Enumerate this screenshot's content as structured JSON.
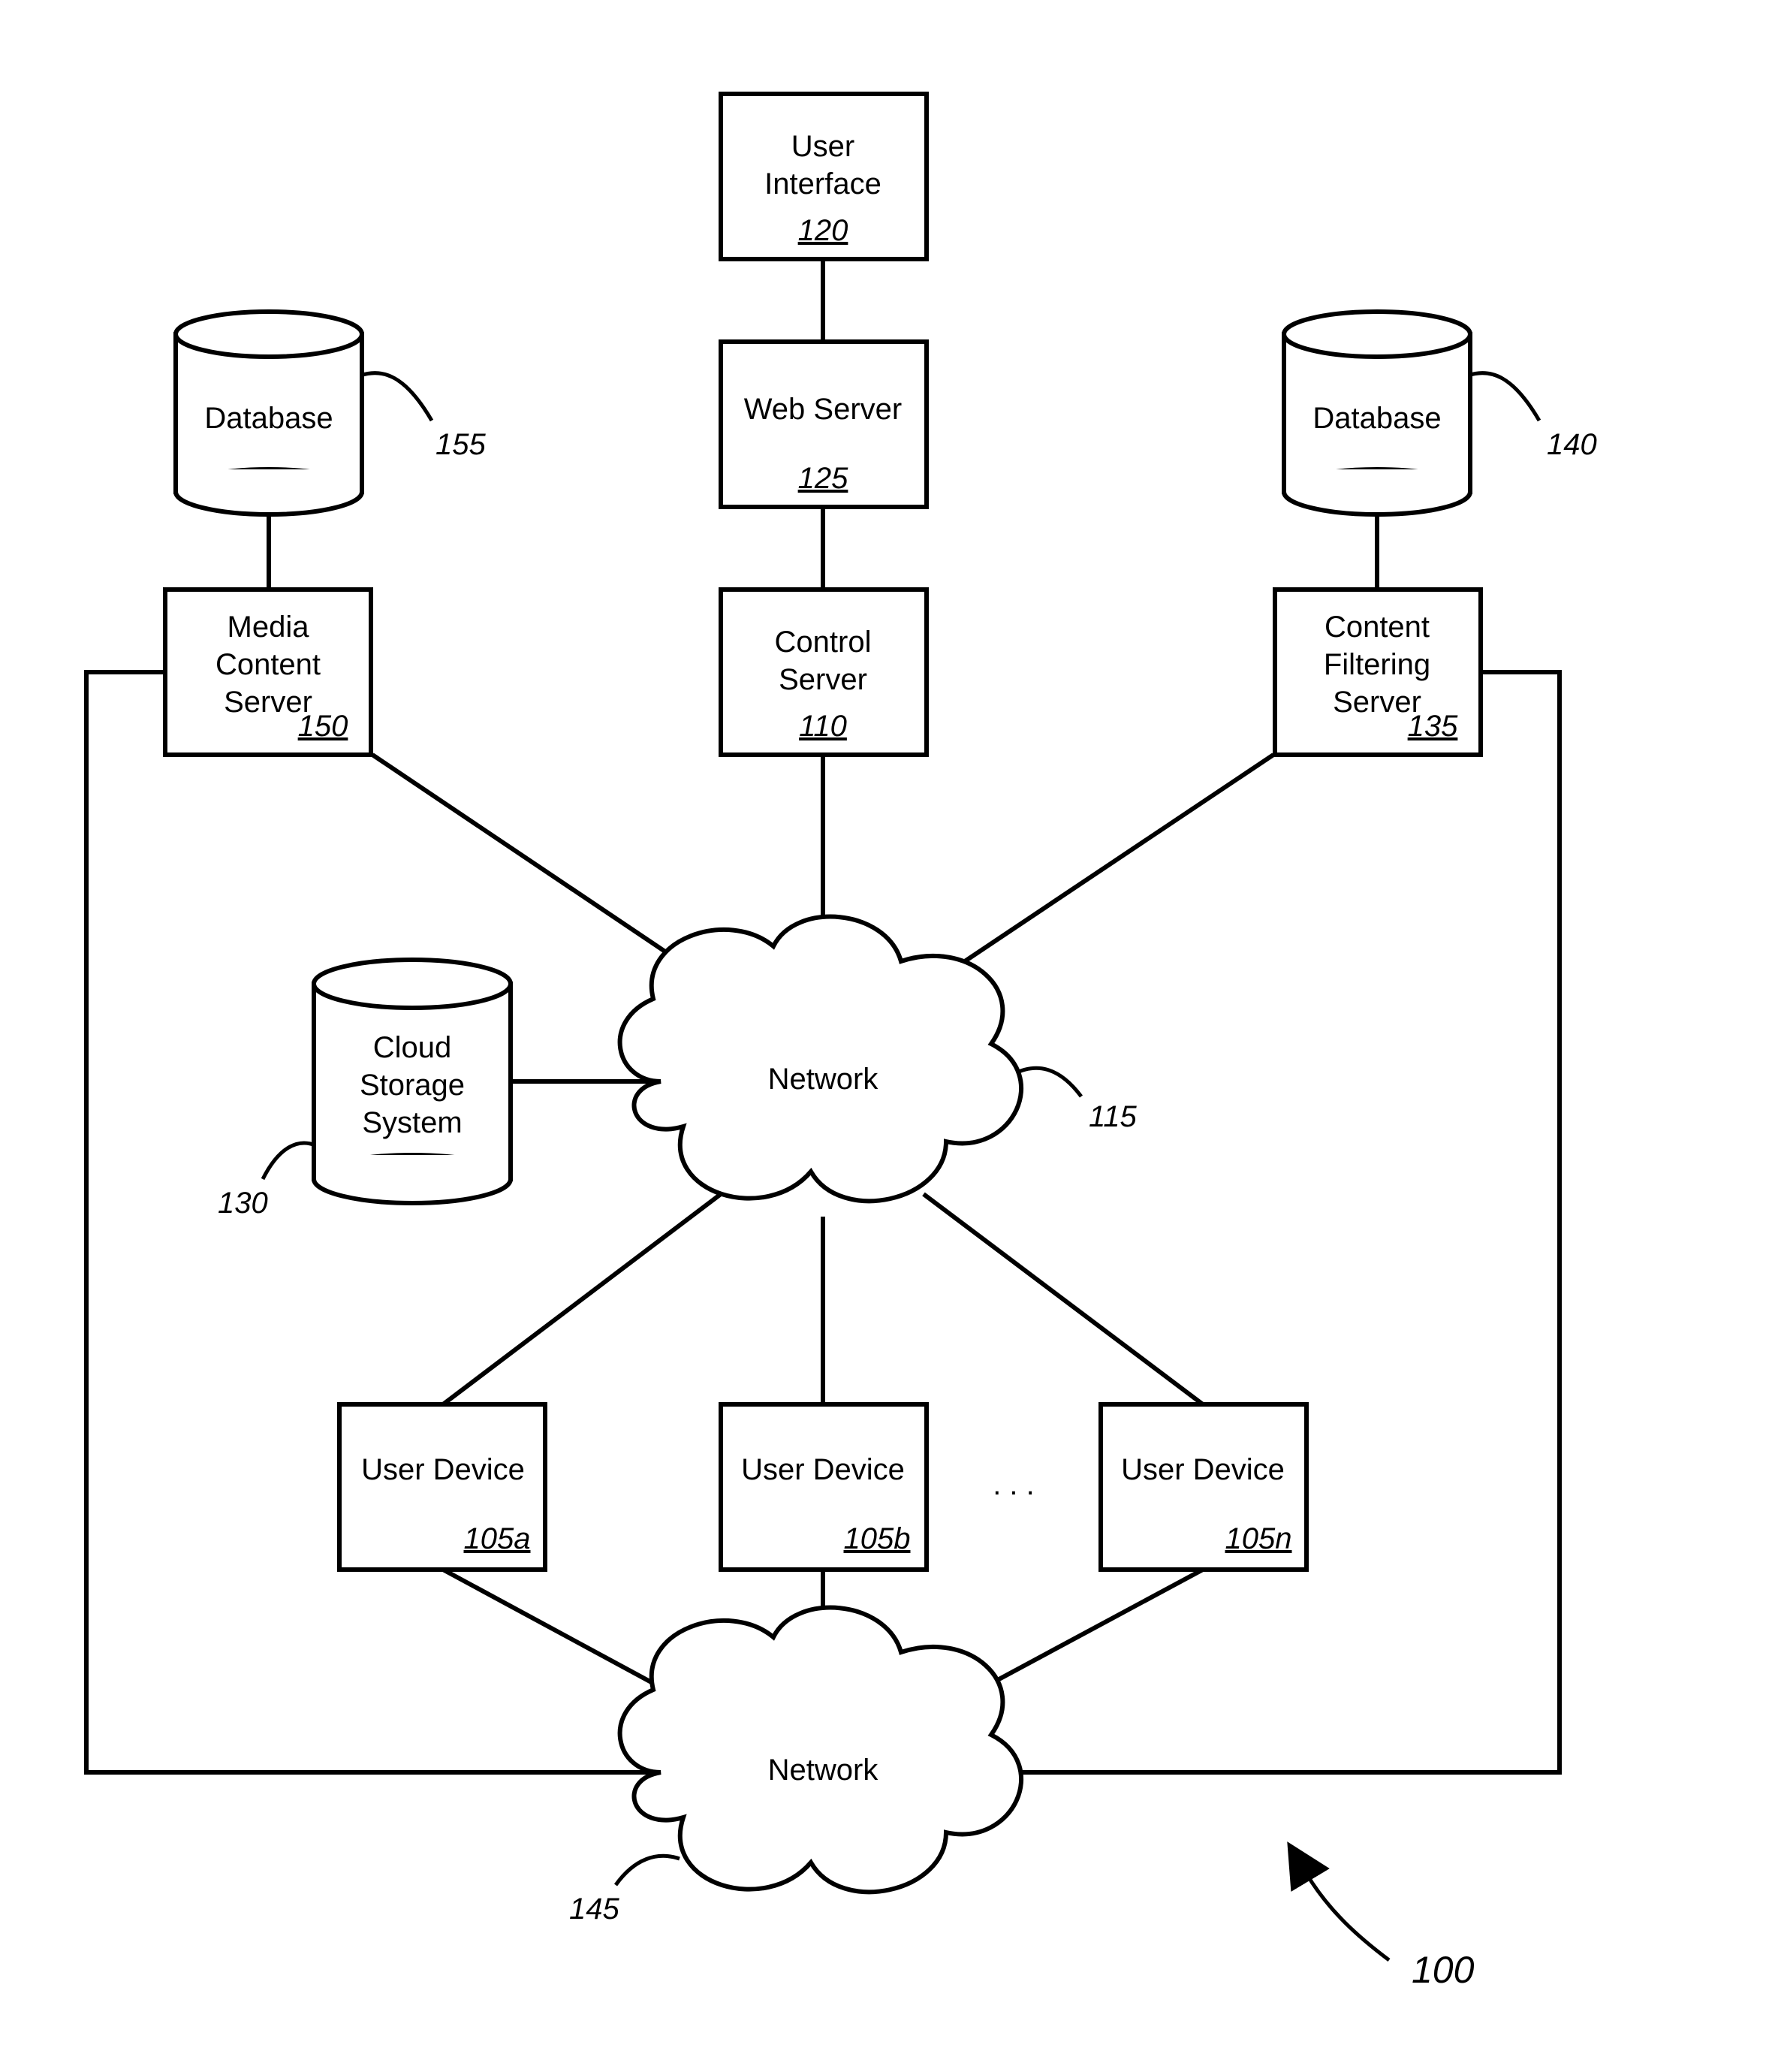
{
  "nodes": {
    "user_interface": {
      "label": "User Interface",
      "ref": "120"
    },
    "web_server": {
      "label": "Web Server",
      "ref": "125"
    },
    "control_server": {
      "label": "Control Server",
      "ref": "110"
    },
    "media_content_server": {
      "label": "Media Content Server",
      "ref": "150"
    },
    "content_filtering_server": {
      "label": "Content Filtering Server",
      "ref": "135"
    },
    "cloud_storage_system": {
      "label": "Cloud Storage System",
      "ref": "130"
    },
    "database_left": {
      "label": "Database",
      "ref": "155"
    },
    "database_right": {
      "label": "Database",
      "ref": "140"
    },
    "network_top": {
      "label": "Network",
      "ref": "115"
    },
    "network_bottom": {
      "label": "Network",
      "ref": "145"
    },
    "user_device_a": {
      "label": "User Device",
      "ref": "105a"
    },
    "user_device_b": {
      "label": "User Device",
      "ref": "105b"
    },
    "user_device_n": {
      "label": "User Device",
      "ref": "105n"
    },
    "ellipsis": {
      "label": ". . ."
    }
  },
  "figure_ref": "100"
}
